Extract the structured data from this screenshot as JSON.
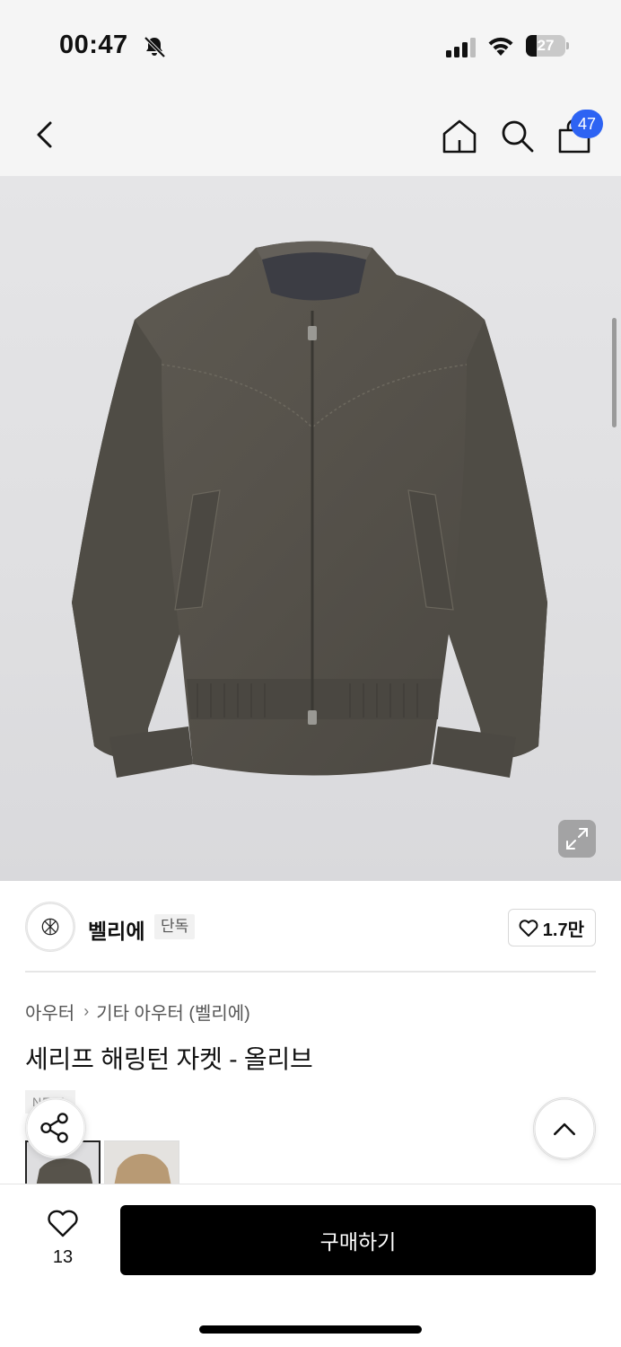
{
  "status_bar": {
    "time": "00:47",
    "battery_level": "27",
    "icons": [
      "bell-off-icon",
      "signal-icon",
      "wifi-icon",
      "battery-icon"
    ]
  },
  "nav": {
    "cart_count": "47",
    "icons": [
      "back-icon",
      "home-icon",
      "search-icon",
      "cart-icon"
    ]
  },
  "product": {
    "image_icons": [
      "expand-icon"
    ],
    "brand": {
      "name": "벨리에",
      "exclusive_tag": "단독",
      "likes": "1.7만"
    },
    "breadcrumb": {
      "category": "아우터",
      "subcategory": "기타 아우터 (벨리에)"
    },
    "title": "세리프 해링턴 자켓 - 올리브",
    "badge": "NEW",
    "color_options": [
      {
        "name": "olive",
        "swatch": "#57534b"
      },
      {
        "name": "beige",
        "swatch": "#b89a74"
      }
    ]
  },
  "bottom_bar": {
    "wish_count": "13",
    "buy_label": "구매하기"
  },
  "colors": {
    "accent": "#2d63f3",
    "buy_button": "#000000",
    "jacket": "#57534b"
  }
}
